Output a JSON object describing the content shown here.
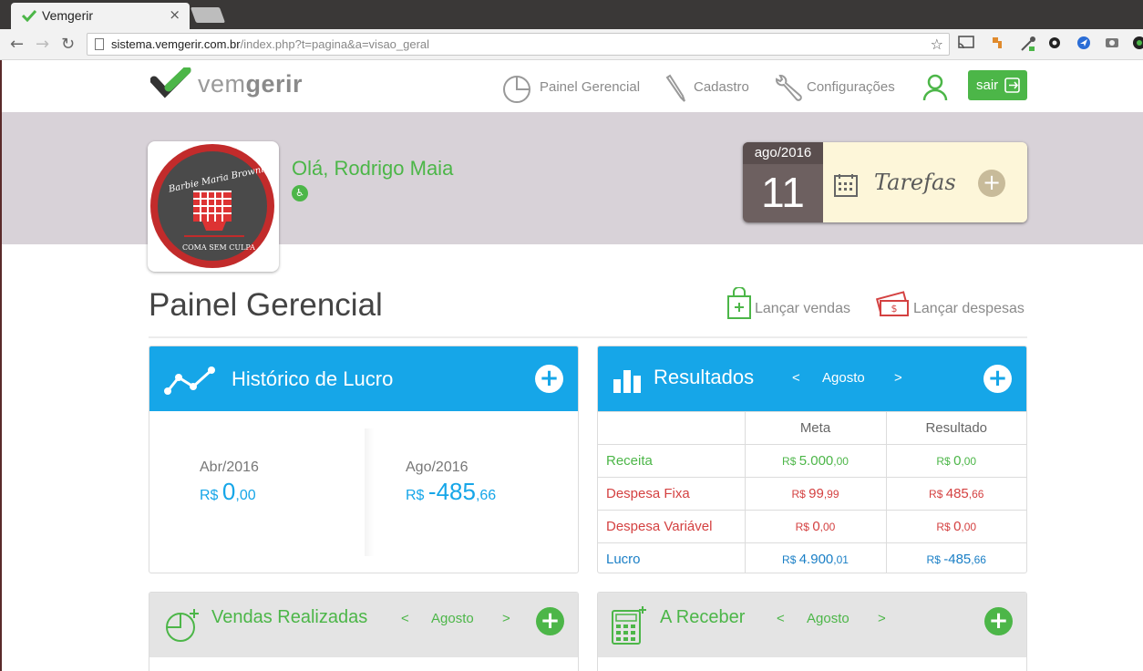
{
  "browser": {
    "tab_title": "Vemgerir",
    "tab_close": "×",
    "url_host": "sistema.vemgerir.com.br",
    "url_path": "/index.php?t=pagina&a=visao_geral",
    "back": "←",
    "forward": "→",
    "reload": "↻",
    "star": "☆"
  },
  "header": {
    "logo_light": "vem",
    "logo_bold": "gerir",
    "menu": [
      {
        "label": "Painel Gerencial",
        "icon": "pie-chart-icon"
      },
      {
        "label": "Cadastro",
        "icon": "pencil-icon"
      },
      {
        "label": "Configurações",
        "icon": "wrench-icon"
      }
    ],
    "logout_label": "sair"
  },
  "profile": {
    "greeting": "Olá, Rodrigo Maia",
    "avatar_text_top": "Barbie Maria Brownie",
    "avatar_text_bottom": "COMA SEM CULPA"
  },
  "tasks": {
    "month": "ago/2016",
    "day": "11",
    "label": "Tarefas",
    "plus": "+"
  },
  "page": {
    "title": "Painel Gerencial",
    "sales_link": "Lançar vendas",
    "expenses_link": "Lançar despesas"
  },
  "history": {
    "title": "Histórico de Lucro",
    "plus": "+",
    "left": {
      "period": "Abr/2016",
      "currency": "R$ ",
      "int": "0",
      "dec": ",00"
    },
    "right": {
      "period": "Ago/2016",
      "currency": "R$ ",
      "int": "-485",
      "dec": ",66"
    }
  },
  "results": {
    "title": "Resultados",
    "prev": "<",
    "month": "Agosto",
    "next": ">",
    "plus": "+",
    "col_meta": "Meta",
    "col_result": "Resultado",
    "rows": [
      {
        "label": "Receita",
        "meta_cur": "R$ ",
        "meta_int": "5.000",
        "meta_dec": ",00",
        "res_cur": "R$ ",
        "res_int": "0",
        "res_dec": ",00"
      },
      {
        "label": "Despesa Fixa",
        "meta_cur": "R$ ",
        "meta_int": "99",
        "meta_dec": ",99",
        "res_cur": "R$ ",
        "res_int": "485",
        "res_dec": ",66"
      },
      {
        "label": "Despesa Variável",
        "meta_cur": "R$ ",
        "meta_int": "0",
        "meta_dec": ",00",
        "res_cur": "R$ ",
        "res_int": "0",
        "res_dec": ",00"
      },
      {
        "label": "Lucro",
        "meta_cur": "R$ ",
        "meta_int": "4.900",
        "meta_dec": ",01",
        "res_cur": "R$ ",
        "res_int": "-485",
        "res_dec": ",66"
      }
    ]
  },
  "sales": {
    "title": "Vendas Realizadas",
    "prev": "<",
    "month": "Agosto",
    "next": ">",
    "plus": "+"
  },
  "receivables": {
    "title": "A Receber",
    "prev": "<",
    "month": "Agosto",
    "next": ">",
    "plus": "+"
  },
  "colors": {
    "brand_green": "#4cb648",
    "panel_blue": "#16a6e8",
    "expense_red": "#d44141",
    "band": "#d8d2d8"
  }
}
